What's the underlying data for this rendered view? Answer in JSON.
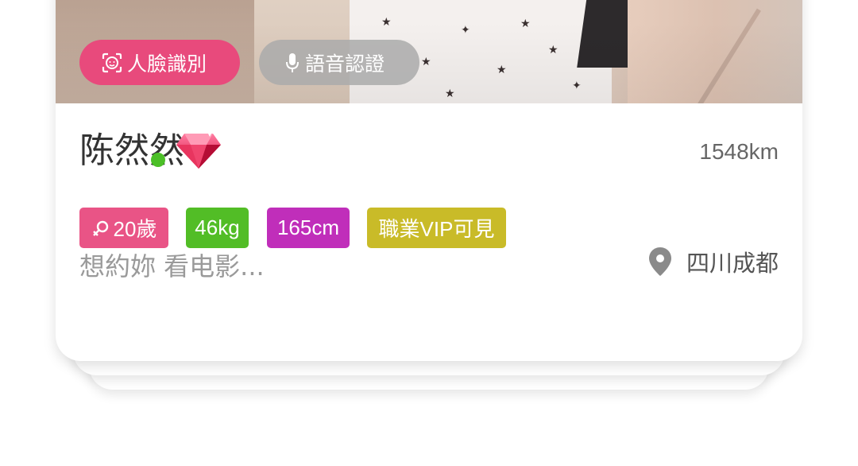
{
  "badges": {
    "face_label": "人臉識別",
    "voice_label": "語音認證"
  },
  "profile": {
    "name": "陈然然",
    "distance": "1548km",
    "motto": "想約妳 看电影...",
    "location": "四川成都"
  },
  "tags": {
    "age": "20歲",
    "weight": "46kg",
    "height": "165cm",
    "job": "職業VIP可見"
  },
  "colors": {
    "face_badge": "#e84a7c",
    "voice_badge": "#aaaaaa",
    "online": "#4bbf27",
    "tag_age": "#e95486",
    "tag_weight": "#52bd26",
    "tag_height": "#c02eba",
    "tag_job": "#c9bb28"
  },
  "icons": [
    "face-scan-icon",
    "microphone-icon",
    "gem-icon",
    "female-icon",
    "location-pin-icon"
  ]
}
